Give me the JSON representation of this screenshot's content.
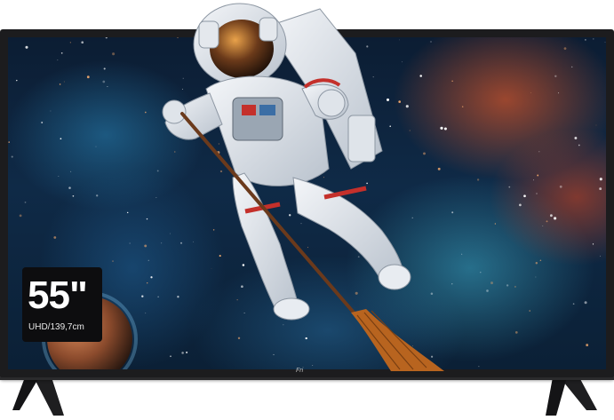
{
  "product": {
    "size_label": "55\"",
    "size_caption": "UHD/139,7cm",
    "brand_mark": "Fri"
  },
  "colors": {
    "bezel": "#1c1c1e",
    "badge": "#0d0d0f",
    "space": "#0f2a47",
    "nebula_orange": "#e65a28",
    "nebula_cyan": "#3caac8",
    "suit_white": "#e9edf2",
    "suit_red": "#c4302b"
  },
  "scene": {
    "subject": "astronaut-icon",
    "prop": "broom-icon",
    "background": "nebula-icon",
    "planet": "planet-icon"
  }
}
